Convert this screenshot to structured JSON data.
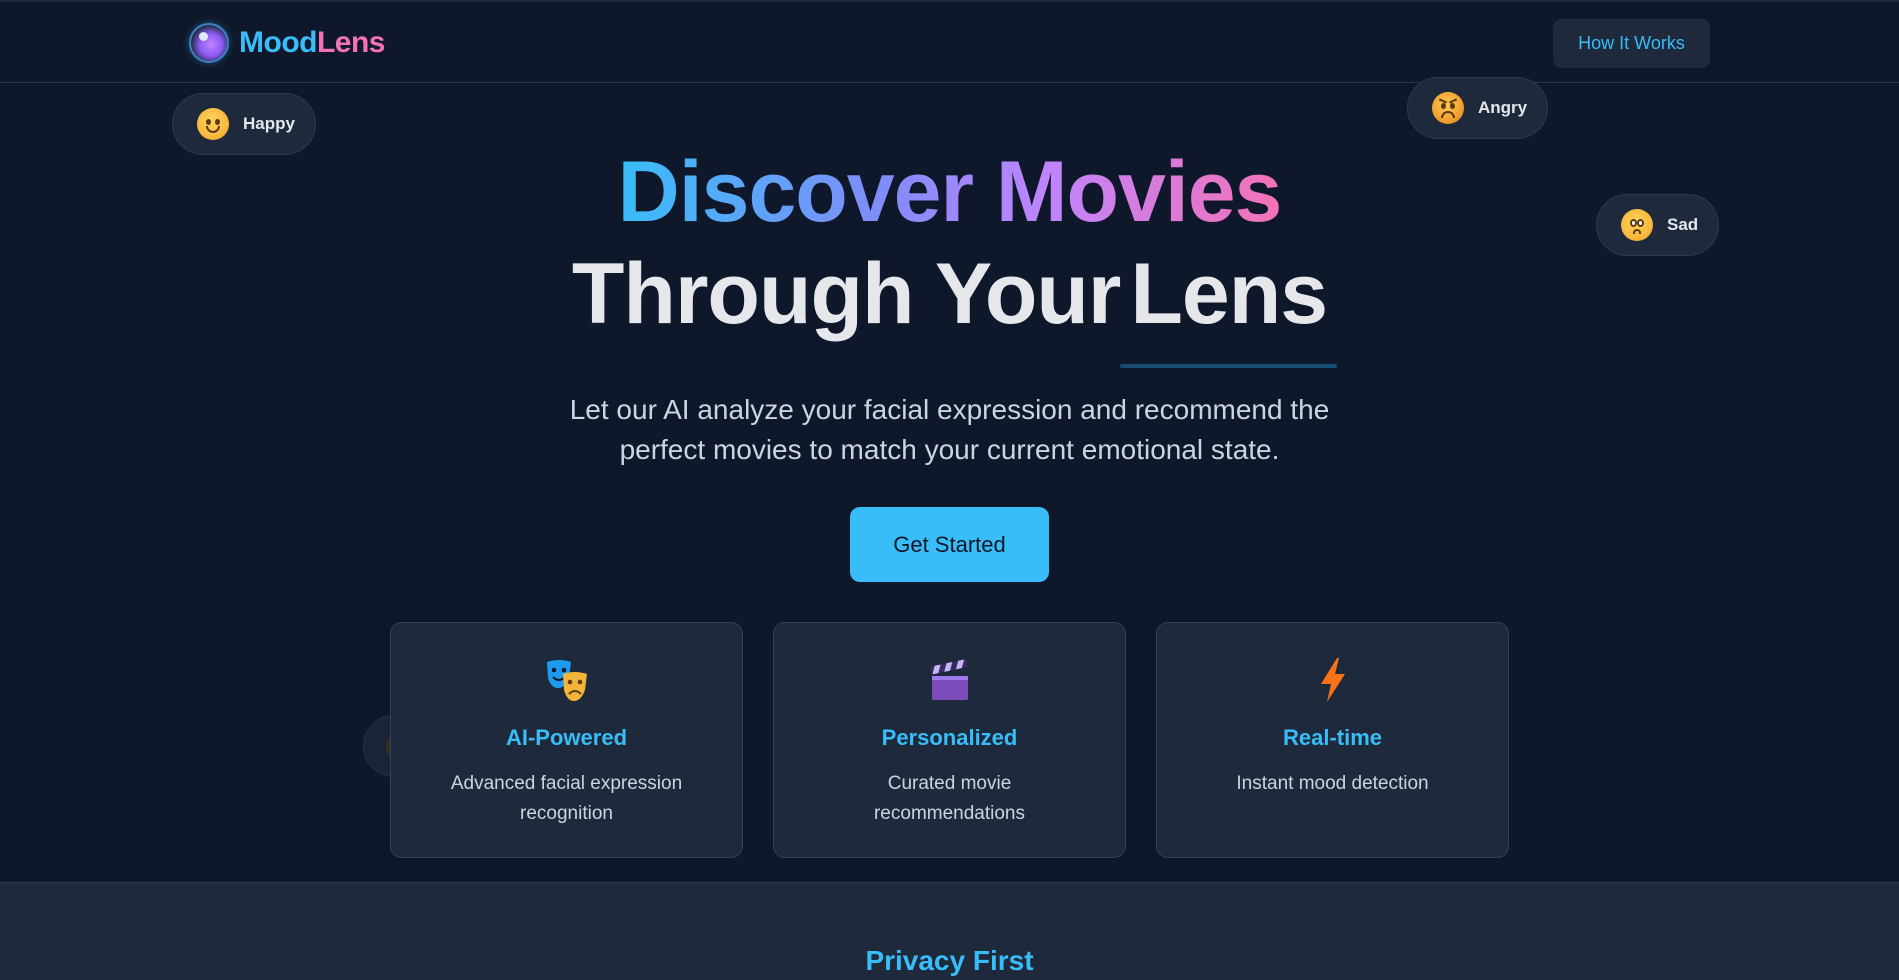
{
  "brand": {
    "part1": "Mood",
    "part2": "Lens"
  },
  "nav": {
    "how_it_works": "How It Works"
  },
  "moods": {
    "happy": "Happy",
    "angry": "Angry",
    "sad": "Sad"
  },
  "hero": {
    "title_line1": "Discover Movies",
    "title_line2_a": "Through Your",
    "title_line2_b": "Lens",
    "subtitle_line1": "Let our AI analyze your facial expression and recommend the",
    "subtitle_line2": "perfect movies to match your current emotional state.",
    "cta": "Get Started"
  },
  "features": [
    {
      "title": "AI-Powered",
      "line1": "Advanced facial expression",
      "line2": "recognition",
      "icon": "theater-masks-icon"
    },
    {
      "title": "Personalized",
      "line1": "Curated movie",
      "line2": "recommendations",
      "icon": "clapperboard-icon"
    },
    {
      "title": "Real-time",
      "line1": "Instant mood detection",
      "line2": "",
      "icon": "lightning-icon"
    }
  ],
  "privacy": {
    "title": "Privacy First"
  },
  "colors": {
    "background": "#0f172a",
    "surface": "#1e293b",
    "accent": "#38bdf8",
    "pink": "#f472b6"
  }
}
